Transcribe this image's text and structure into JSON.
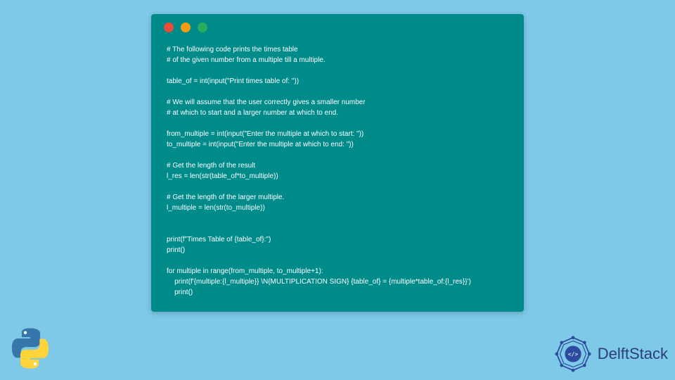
{
  "code_lines": [
    "# The following code prints the times table",
    "# of the given number from a multiple till a multiple.",
    "",
    "table_of = int(input(\"Print times table of: \"))",
    "",
    "# We will assume that the user correctly gives a smaller number",
    "# at which to start and a larger number at which to end.",
    "",
    "from_multiple = int(input(\"Enter the multiple at which to start: \"))",
    "to_multiple = int(input(\"Enter the multiple at which to end: \"))",
    "",
    "# Get the length of the result",
    "l_res = len(str(table_of*to_multiple))",
    "",
    "# Get the length of the larger multiple.",
    "l_multiple = len(str(to_multiple))",
    "",
    "",
    "print(f\"Times Table of {table_of}:\")",
    "print()",
    "",
    "for multiple in range(from_multiple, to_multiple+1):",
    "    print(f'{multiple:{l_multiple}} \\N{MULTIPLICATION SIGN} {table_of} = {multiple*table_of:{l_res}}')",
    "    print()"
  ],
  "brand": {
    "name": "DelftStack"
  }
}
